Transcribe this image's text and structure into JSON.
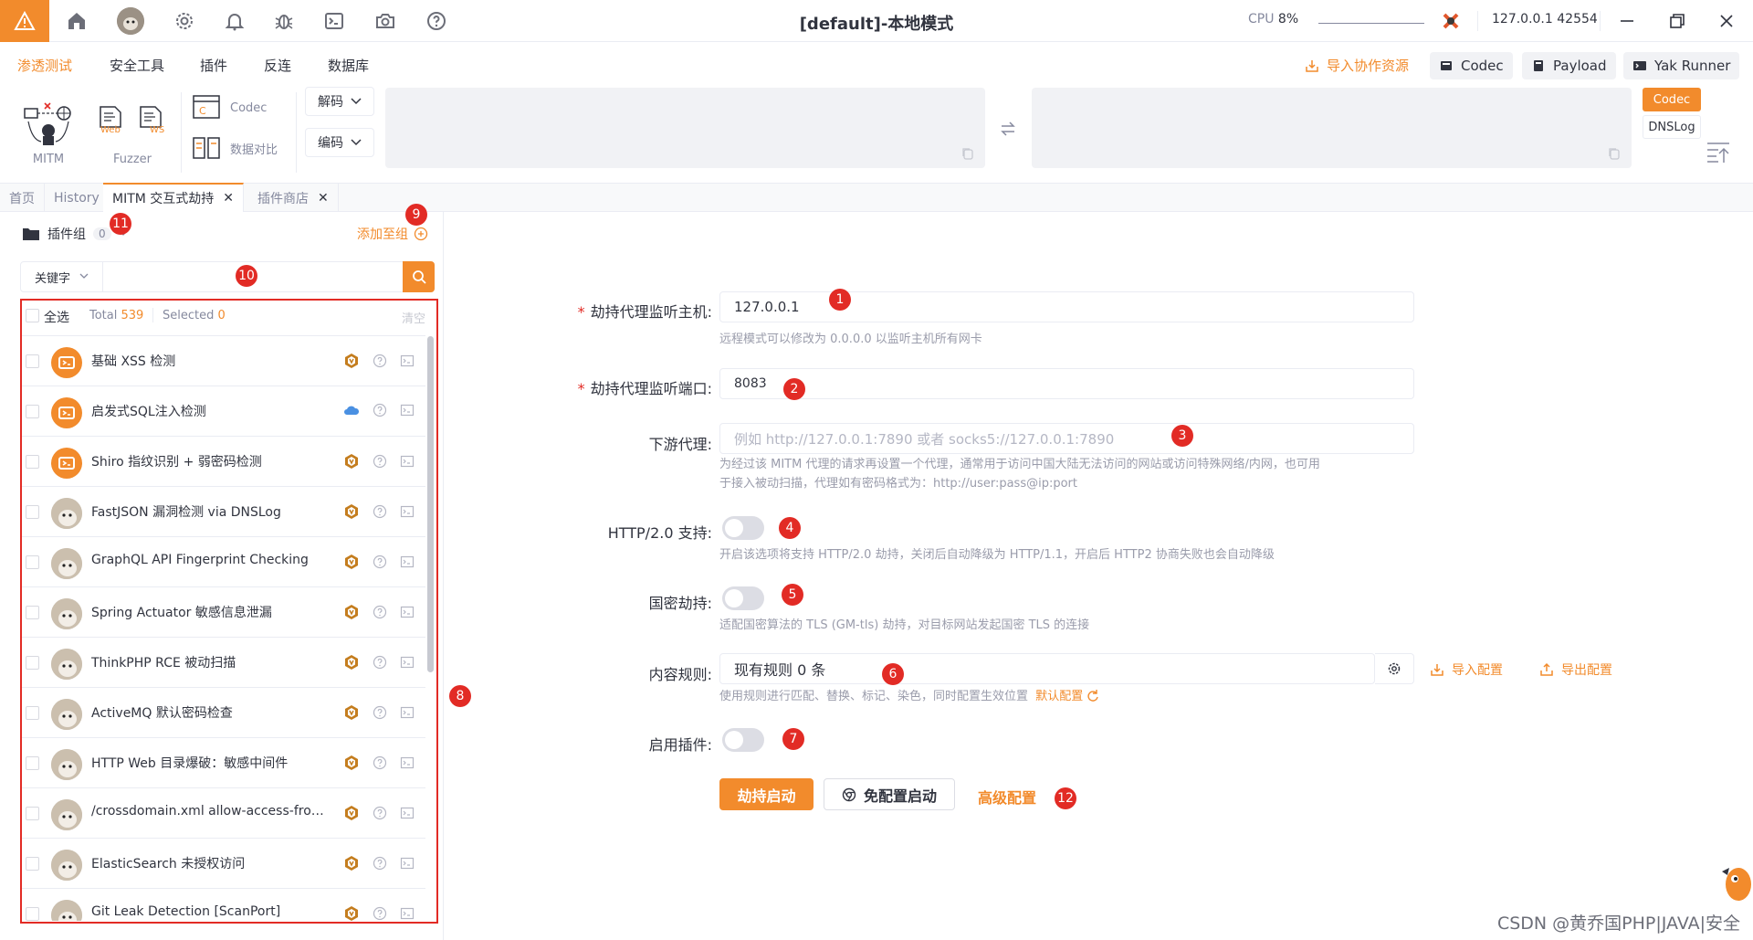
{
  "window": {
    "title": "[default]-本地模式",
    "cpu_label": "CPU",
    "cpu_value": "8%",
    "ip": "127.0.0.1",
    "port": "42554"
  },
  "menu": {
    "items": [
      "渗透测试",
      "安全工具",
      "插件",
      "反连",
      "数据库"
    ],
    "import_resources": "导入协作资源",
    "codec": "Codec",
    "payload": "Payload",
    "yak_runner": "Yak Runner"
  },
  "ribbon": {
    "mitm": "MITM",
    "fuzzer": "Fuzzer",
    "web": "Web",
    "ws": "WS",
    "codec": "Codec",
    "data_compare": "数据对比",
    "decode": "解码",
    "encode": "编码",
    "side_codec": "Codec",
    "side_dnslog": "DNSLog"
  },
  "tabs": [
    {
      "label": "首页"
    },
    {
      "label": "History"
    },
    {
      "label": "MITM 交互式劫持"
    },
    {
      "label": "插件商店"
    }
  ],
  "left": {
    "plugin_group_label": "插件组",
    "plugin_group_count": "0",
    "add_to_group": "添加至组",
    "keyword": "关键字",
    "select_all": "全选",
    "total_label": "Total",
    "total_value": "539",
    "selected_label": "Selected",
    "selected_value": "0",
    "clear": "清空",
    "plugins": [
      {
        "name": "基础 XSS 检测",
        "avatar": "orange",
        "tag": "shield"
      },
      {
        "name": "启发式SQL注入检测",
        "avatar": "orange",
        "tag": "cloud"
      },
      {
        "name": "Shiro 指纹识别 + 弱密码检测",
        "avatar": "orange",
        "tag": "shield"
      },
      {
        "name": "FastJSON 漏洞检测 via DNSLog",
        "avatar": "photo",
        "tag": "shield"
      },
      {
        "name": "GraphQL API Fingerprint Checking",
        "avatar": "photo",
        "tag": "shield"
      },
      {
        "name": "Spring Actuator 敏感信息泄漏",
        "avatar": "photo",
        "tag": "shield"
      },
      {
        "name": "ThinkPHP RCE 被动扫描",
        "avatar": "photo",
        "tag": "shield"
      },
      {
        "name": "ActiveMQ 默认密码检查",
        "avatar": "photo",
        "tag": "shield"
      },
      {
        "name": "HTTP Web 目录爆破：敏感中间件",
        "avatar": "photo",
        "tag": "shield"
      },
      {
        "name": "/crossdomain.xml allow-access-from ...",
        "avatar": "photo",
        "tag": "shield"
      },
      {
        "name": "ElasticSearch 未授权访问",
        "avatar": "photo",
        "tag": "shield"
      },
      {
        "name": "Git Leak Detection [ScanPort]",
        "avatar": "photo",
        "tag": "shield"
      }
    ]
  },
  "form": {
    "host_label": "劫持代理监听主机:",
    "host_value": "127.0.0.1",
    "host_help": "远程模式可以修改为 0.0.0.0 以监听主机所有网卡",
    "port_label": "劫持代理监听端口:",
    "port_value": "8083",
    "downstream_label": "下游代理:",
    "downstream_placeholder": "例如 http://127.0.0.1:7890 或者 socks5://127.0.0.1:7890",
    "downstream_help_1": "为经过该 MITM 代理的请求再设置一个代理，通常用于访问中国大陆无法访问的网站或访问特殊网络/内网，也可用",
    "downstream_help_2": "于接入被动扫描，代理如有密码格式为：http://user:pass@ip:port",
    "http2_label": "HTTP/2.0 支持:",
    "http2_help": "开启该选项将支持 HTTP/2.0 劫持，关闭后自动降级为 HTTP/1.1，开启后 HTTP2 协商失败也会自动降级",
    "gm_label": "国密劫持:",
    "gm_help": "适配国密算法的 TLS (GM-tls) 劫持，对目标网站发起国密 TLS 的连接",
    "rules_label": "内容规则:",
    "rules_value": "现有规则 0 条",
    "import_config": "导入配置",
    "export_config": "导出配置",
    "rules_help": "使用规则进行匹配、替换、标记、染色，同时配置生效位置",
    "default_config": "默认配置",
    "plugins_label": "启用插件:",
    "start_button": "劫持启动",
    "free_start_button": "免配置启动",
    "advanced": "高级配置"
  },
  "badges": [
    "1",
    "2",
    "3",
    "4",
    "5",
    "6",
    "7",
    "8",
    "9",
    "10",
    "11",
    "12"
  ],
  "watermark": "CSDN @黄乔国PHP|JAVA|安全",
  "colors": {
    "accent": "#f28b2c",
    "badge": "#e22b25"
  }
}
